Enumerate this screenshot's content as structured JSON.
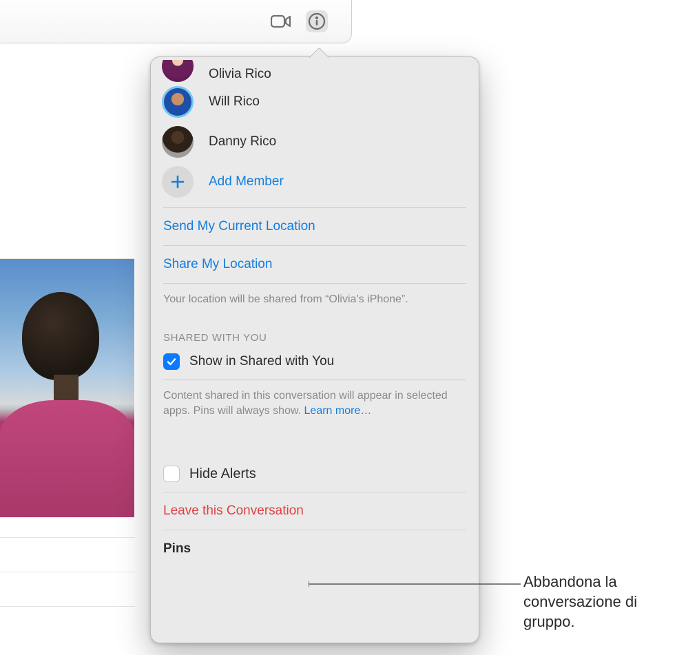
{
  "toolbar": {
    "video_icon": "video-camera",
    "info_icon": "info-circle"
  },
  "members": [
    {
      "name": "Olivia Rico",
      "avatar": "olivia",
      "partial": true
    },
    {
      "name": "Will Rico",
      "avatar": "will"
    },
    {
      "name": "Danny Rico",
      "avatar": "danny"
    }
  ],
  "add_member_label": "Add Member",
  "actions": {
    "send_location": "Send My Current Location",
    "share_location": "Share My Location",
    "share_hint": "Your location will be shared from “Olivia’s iPhone”."
  },
  "shared_with_you": {
    "header": "SHARED WITH YOU",
    "checkbox_label": "Show in Shared with You",
    "checked": true,
    "description": "Content shared in this conversation will appear in selected apps. Pins will always show. ",
    "learn_more": "Learn more…"
  },
  "hide_alerts": {
    "label": "Hide Alerts",
    "checked": false
  },
  "leave_label": "Leave this Conversation",
  "pins_header": "Pins",
  "annotation": "Abbandona la conversazione di gruppo.",
  "colors": {
    "accent": "#127ee0",
    "danger": "#e04040"
  }
}
